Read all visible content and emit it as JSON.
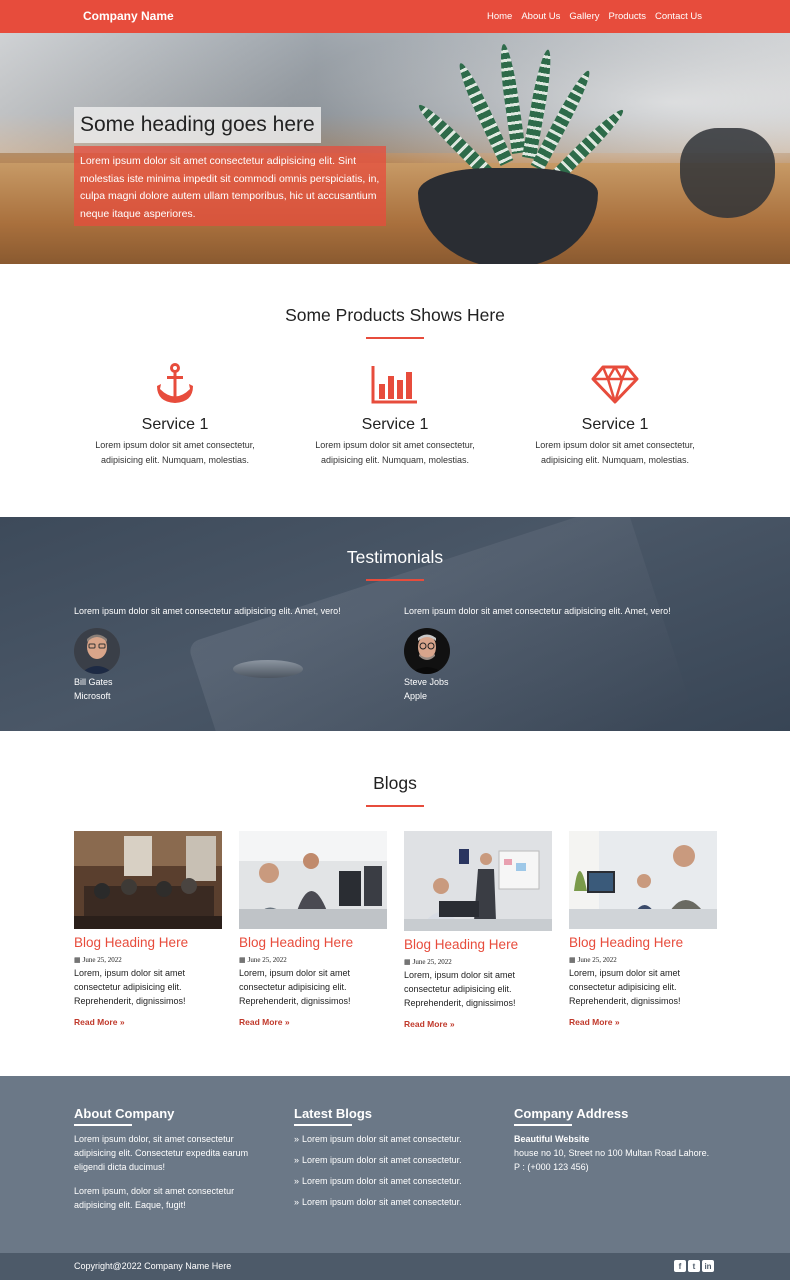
{
  "colors": {
    "accent": "#e74c3c",
    "testimonials_bg": "#3d4a5a",
    "footer_bg": "#6b7887",
    "copyright_bg": "#4d5a69"
  },
  "nav": {
    "brand": "Company Name",
    "items": [
      {
        "label": "Home"
      },
      {
        "label": "About Us"
      },
      {
        "label": "Gallery"
      },
      {
        "label": "Products"
      },
      {
        "label": "Contact Us"
      }
    ]
  },
  "hero": {
    "title": "Some heading goes here",
    "text": "Lorem ipsum dolor sit amet consectetur adipisicing elit. Sint molestias iste minima impedit sit commodi omnis perspiciatis, in, culpa magni dolore autem ullam temporibus, hic ut accusantium neque itaque asperiores."
  },
  "products": {
    "title": "Some Products Shows Here",
    "services": [
      {
        "icon": "anchor-icon",
        "title": "Service 1",
        "text": "Lorem ipsum dolor sit amet consectetur, adipisicing elit. Numquam, molestias."
      },
      {
        "icon": "bar-chart-icon",
        "title": "Service 1",
        "text": "Lorem ipsum dolor sit amet consectetur, adipisicing elit. Numquam, molestias."
      },
      {
        "icon": "diamond-icon",
        "title": "Service 1",
        "text": "Lorem ipsum dolor sit amet consectetur, adipisicing elit. Numquam, molestias."
      }
    ]
  },
  "testimonials": {
    "title": "Testimonials",
    "items": [
      {
        "quote": "Lorem ipsum dolor sit amet consectetur adipisicing elit. Amet, vero!",
        "name": "Bill Gates",
        "company": "Microsoft"
      },
      {
        "quote": "Lorem ipsum dolor sit amet consectetur adipisicing elit. Amet, vero!",
        "name": "Steve Jobs",
        "company": "Apple"
      }
    ]
  },
  "blogs": {
    "title": "Blogs",
    "items": [
      {
        "heading": "Blog Heading Here",
        "date": "June 25, 2022",
        "text": "Lorem, ipsum dolor sit amet consectetur adipisicing elit. Reprehenderit, dignissimos!",
        "more": "Read More"
      },
      {
        "heading": "Blog Heading Here",
        "date": "June 25, 2022",
        "text": "Lorem, ipsum dolor sit amet consectetur adipisicing elit. Reprehenderit, dignissimos!",
        "more": "Read More"
      },
      {
        "heading": "Blog Heading Here",
        "date": "June 25, 2022",
        "text": "Lorem, ipsum dolor sit amet consectetur adipisicing elit. Reprehenderit, dignissimos!",
        "more": "Read More"
      },
      {
        "heading": "Blog Heading Here",
        "date": "June 25, 2022",
        "text": "Lorem, ipsum dolor sit amet consectetur adipisicing elit. Reprehenderit, dignissimos!",
        "more": "Read More"
      }
    ]
  },
  "footer": {
    "about": {
      "title": "About Company",
      "p1": "Lorem ipsum dolor, sit amet consectetur adipisicing elit. Consectetur expedita earum eligendi dicta ducimus!",
      "p2": "Lorem ipsum, dolor sit amet consectetur adipisicing elit. Eaque, fugit!"
    },
    "latest": {
      "title": "Latest Blogs",
      "links": [
        "Lorem ipsum dolor sit amet consectetur.",
        "Lorem ipsum dolor sit amet consectetur.",
        "Lorem ipsum dolor sit amet consectetur.",
        "Lorem ipsum dolor sit amet consectetur."
      ]
    },
    "address": {
      "title": "Company Address",
      "name": "Beautiful Website",
      "line": "house no 10, Street no 100 Multan Road Lahore.",
      "phone": "P : (+000 123 456)"
    },
    "copyright": "Copyright@2022 Company Name Here",
    "social": [
      "facebook-icon",
      "twitter-icon",
      "linkedin-icon"
    ]
  }
}
